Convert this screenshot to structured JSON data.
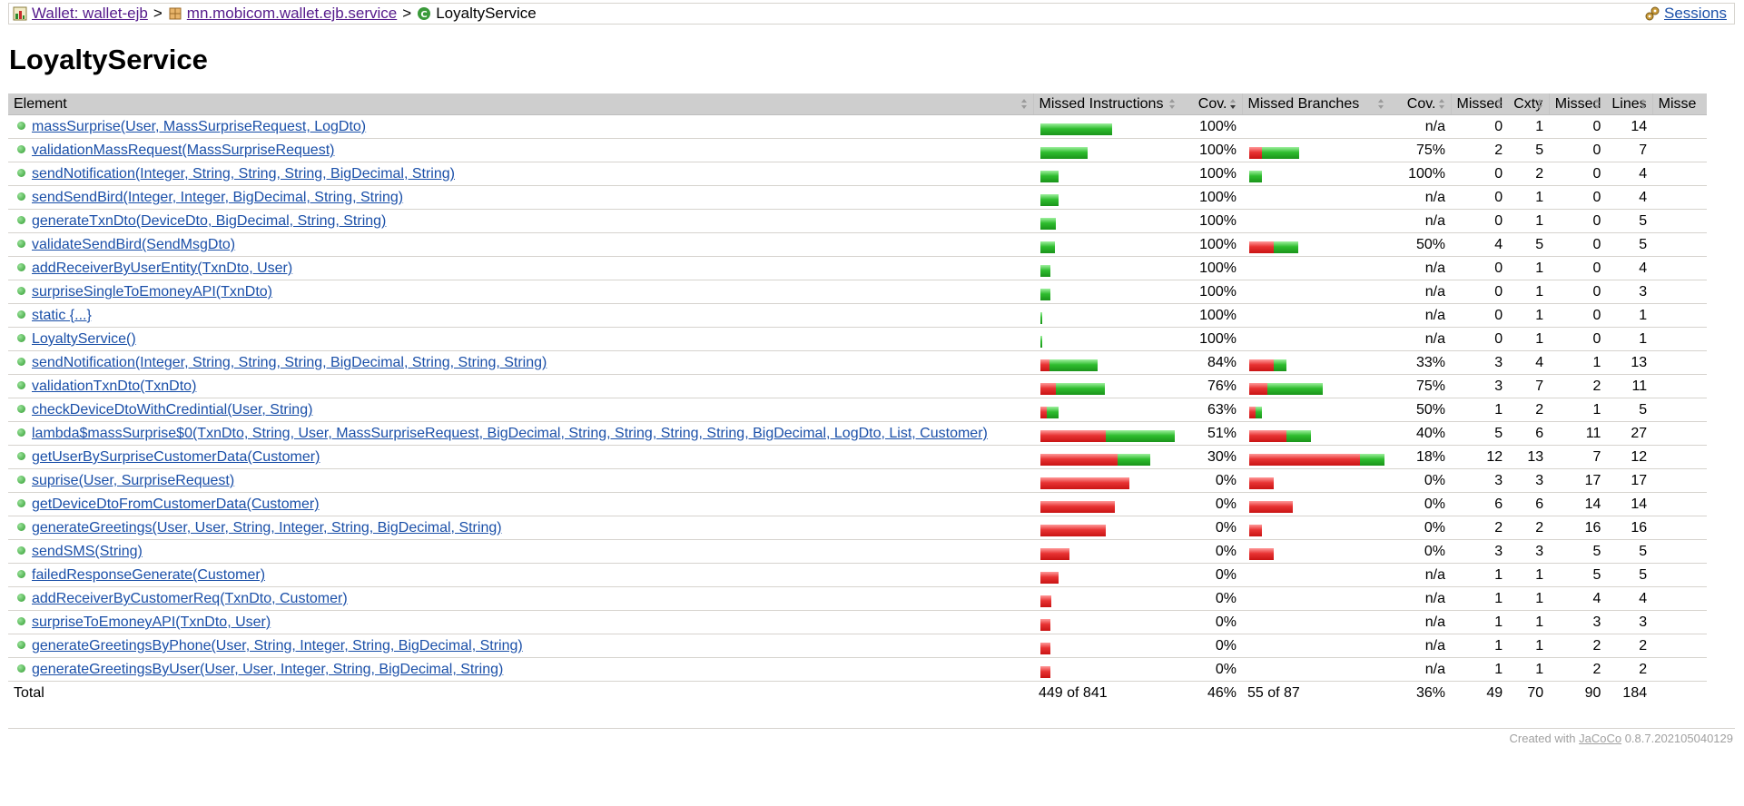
{
  "breadcrumb": {
    "report_label": "Wallet: wallet-ejb",
    "package_label": "mn.mobicom.wallet.ejb.service",
    "class_label": "LoyaltyService",
    "separator": ">",
    "sessions_label": "Sessions"
  },
  "page_title": "LoyaltyService",
  "columns": {
    "element": "Element",
    "missed_instructions": "Missed Instructions",
    "cov1": "Cov.",
    "missed_branches": "Missed Branches",
    "cov2": "Cov.",
    "missed_cxty": "Missed",
    "cxty": "Cxty",
    "missed_lines": "Missed",
    "lines": "Lines",
    "missed_methods": "Misse"
  },
  "colors": {
    "link": "#1a4fa8",
    "bar_red": "#e83333",
    "bar_green": "#2fbd2f",
    "header_bg": "#cecece"
  },
  "rows": [
    {
      "name": "massSurprise(User, MassSurpriseRequest, LogDto)",
      "instr_missed": 0,
      "instr_total": 66,
      "cov1": "100%",
      "br_missed": 0,
      "br_total": 0,
      "cov2": "n/a",
      "missed_cxty": "0",
      "cxty": "1",
      "missed_lines": "0",
      "lines": "14"
    },
    {
      "name": "validationMassRequest(MassSurpriseRequest)",
      "instr_missed": 0,
      "instr_total": 43,
      "cov1": "100%",
      "br_missed": 2,
      "br_total": 8,
      "cov2": "75%",
      "missed_cxty": "2",
      "cxty": "5",
      "missed_lines": "0",
      "lines": "7"
    },
    {
      "name": "sendNotification(Integer, String, String, String, BigDecimal, String)",
      "instr_missed": 0,
      "instr_total": 17,
      "cov1": "100%",
      "br_missed": 0,
      "br_total": 2,
      "cov2": "100%",
      "missed_cxty": "0",
      "cxty": "2",
      "missed_lines": "0",
      "lines": "4"
    },
    {
      "name": "sendSendBird(Integer, Integer, BigDecimal, String, String)",
      "instr_missed": 0,
      "instr_total": 17,
      "cov1": "100%",
      "br_missed": 0,
      "br_total": 0,
      "cov2": "n/a",
      "missed_cxty": "0",
      "cxty": "1",
      "missed_lines": "0",
      "lines": "4"
    },
    {
      "name": "generateTxnDto(DeviceDto, BigDecimal, String, String)",
      "instr_missed": 0,
      "instr_total": 14,
      "cov1": "100%",
      "br_missed": 0,
      "br_total": 0,
      "cov2": "n/a",
      "missed_cxty": "0",
      "cxty": "1",
      "missed_lines": "0",
      "lines": "5"
    },
    {
      "name": "validateSendBird(SendMsgDto)",
      "instr_missed": 0,
      "instr_total": 13,
      "cov1": "100%",
      "br_missed": 4,
      "br_total": 8,
      "cov2": "50%",
      "missed_cxty": "4",
      "cxty": "5",
      "missed_lines": "0",
      "lines": "5"
    },
    {
      "name": "addReceiverByUserEntity(TxnDto, User)",
      "instr_missed": 0,
      "instr_total": 9,
      "cov1": "100%",
      "br_missed": 0,
      "br_total": 0,
      "cov2": "n/a",
      "missed_cxty": "0",
      "cxty": "1",
      "missed_lines": "0",
      "lines": "4"
    },
    {
      "name": "surpriseSingleToEmoneyAPI(TxnDto)",
      "instr_missed": 0,
      "instr_total": 9,
      "cov1": "100%",
      "br_missed": 0,
      "br_total": 0,
      "cov2": "n/a",
      "missed_cxty": "0",
      "cxty": "1",
      "missed_lines": "0",
      "lines": "3"
    },
    {
      "name": "static {...}",
      "instr_missed": 0,
      "instr_total": 2,
      "cov1": "100%",
      "br_missed": 0,
      "br_total": 0,
      "cov2": "n/a",
      "missed_cxty": "0",
      "cxty": "1",
      "missed_lines": "0",
      "lines": "1"
    },
    {
      "name": "LoyaltyService()",
      "instr_missed": 0,
      "instr_total": 1.5,
      "cov1": "100%",
      "br_missed": 0,
      "br_total": 0,
      "cov2": "n/a",
      "missed_cxty": "0",
      "cxty": "1",
      "missed_lines": "0",
      "lines": "1"
    },
    {
      "name": "sendNotification(Integer, String, String, String, BigDecimal, String, String, String)",
      "instr_missed": 8,
      "instr_total": 52,
      "cov1": "84%",
      "br_missed": 4,
      "br_total": 6,
      "cov2": "33%",
      "missed_cxty": "3",
      "cxty": "4",
      "missed_lines": "1",
      "lines": "13"
    },
    {
      "name": "validationTxnDto(TxnDto)",
      "instr_missed": 14,
      "instr_total": 59,
      "cov1": "76%",
      "br_missed": 3,
      "br_total": 12,
      "cov2": "75%",
      "missed_cxty": "3",
      "cxty": "7",
      "missed_lines": "2",
      "lines": "11"
    },
    {
      "name": "checkDeviceDtoWithCredintial(User, String)",
      "instr_missed": 6,
      "instr_total": 17,
      "cov1": "63%",
      "br_missed": 1,
      "br_total": 2,
      "cov2": "50%",
      "missed_cxty": "1",
      "cxty": "2",
      "missed_lines": "1",
      "lines": "5"
    },
    {
      "name": "lambda$massSurprise$0(TxnDto, String, User, MassSurpriseRequest, BigDecimal, String, String, String, String, BigDecimal, LogDto, List, Customer)",
      "instr_missed": 60,
      "instr_total": 123,
      "cov1": "51%",
      "br_missed": 6,
      "br_total": 10,
      "cov2": "40%",
      "missed_cxty": "5",
      "cxty": "6",
      "missed_lines": "11",
      "lines": "27"
    },
    {
      "name": "getUserBySurpriseCustomerData(Customer)",
      "instr_missed": 71,
      "instr_total": 101,
      "cov1": "30%",
      "br_missed": 18,
      "br_total": 22,
      "cov2": "18%",
      "missed_cxty": "12",
      "cxty": "13",
      "missed_lines": "7",
      "lines": "12"
    },
    {
      "name": "suprise(User, SurpriseRequest)",
      "instr_missed": 82,
      "instr_total": 82,
      "cov1": "0%",
      "br_missed": 4,
      "br_total": 4,
      "cov2": "0%",
      "missed_cxty": "3",
      "cxty": "3",
      "missed_lines": "17",
      "lines": "17"
    },
    {
      "name": "getDeviceDtoFromCustomerData(Customer)",
      "instr_missed": 68,
      "instr_total": 68,
      "cov1": "0%",
      "br_missed": 7,
      "br_total": 7,
      "cov2": "0%",
      "missed_cxty": "6",
      "cxty": "6",
      "missed_lines": "14",
      "lines": "14"
    },
    {
      "name": "generateGreetings(User, User, String, Integer, String, BigDecimal, String)",
      "instr_missed": 60,
      "instr_total": 60,
      "cov1": "0%",
      "br_missed": 2,
      "br_total": 2,
      "cov2": "0%",
      "missed_cxty": "2",
      "cxty": "2",
      "missed_lines": "16",
      "lines": "16"
    },
    {
      "name": "sendSMS(String)",
      "instr_missed": 27,
      "instr_total": 27,
      "cov1": "0%",
      "br_missed": 4,
      "br_total": 4,
      "cov2": "0%",
      "missed_cxty": "3",
      "cxty": "3",
      "missed_lines": "5",
      "lines": "5"
    },
    {
      "name": "failedResponseGenerate(Customer)",
      "instr_missed": 17,
      "instr_total": 17,
      "cov1": "0%",
      "br_missed": 0,
      "br_total": 0,
      "cov2": "n/a",
      "missed_cxty": "1",
      "cxty": "1",
      "missed_lines": "5",
      "lines": "5"
    },
    {
      "name": "addReceiverByCustomerReq(TxnDto, Customer)",
      "instr_missed": 10,
      "instr_total": 10,
      "cov1": "0%",
      "br_missed": 0,
      "br_total": 0,
      "cov2": "n/a",
      "missed_cxty": "1",
      "cxty": "1",
      "missed_lines": "4",
      "lines": "4"
    },
    {
      "name": "surpriseToEmoneyAPI(TxnDto, User)",
      "instr_missed": 9,
      "instr_total": 9,
      "cov1": "0%",
      "br_missed": 0,
      "br_total": 0,
      "cov2": "n/a",
      "missed_cxty": "1",
      "cxty": "1",
      "missed_lines": "3",
      "lines": "3"
    },
    {
      "name": "generateGreetingsByPhone(User, String, Integer, String, BigDecimal, String)",
      "instr_missed": 9,
      "instr_total": 9,
      "cov1": "0%",
      "br_missed": 0,
      "br_total": 0,
      "cov2": "n/a",
      "missed_cxty": "1",
      "cxty": "1",
      "missed_lines": "2",
      "lines": "2"
    },
    {
      "name": "generateGreetingsByUser(User, User, Integer, String, BigDecimal, String)",
      "instr_missed": 9,
      "instr_total": 9,
      "cov1": "0%",
      "br_missed": 0,
      "br_total": 0,
      "cov2": "n/a",
      "missed_cxty": "1",
      "cxty": "1",
      "missed_lines": "2",
      "lines": "2"
    }
  ],
  "total": {
    "label": "Total",
    "missed_instructions": "449 of 841",
    "cov1": "46%",
    "missed_branches": "55 of 87",
    "cov2": "36%",
    "missed_cxty": "49",
    "cxty": "70",
    "missed_lines": "90",
    "lines": "184"
  },
  "footer": {
    "prefix": "Created with",
    "link_label": "JaCoCo",
    "version": "0.8.7.202105040129"
  }
}
